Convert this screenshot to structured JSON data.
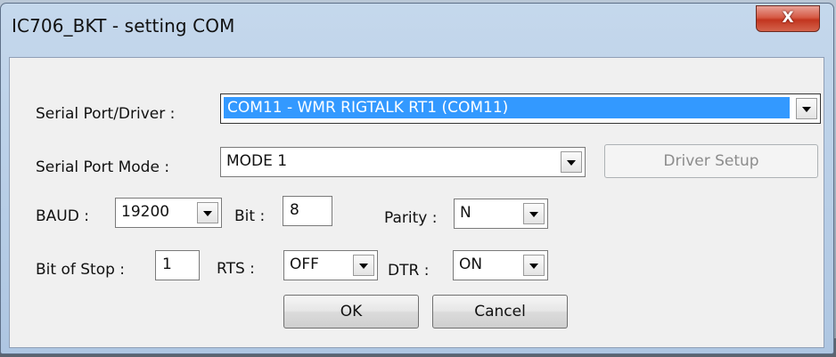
{
  "window": {
    "title": "IC706_BKT - setting COM",
    "close_label": "X"
  },
  "serial_port": {
    "label": "Serial Port/Driver :",
    "value": "COM11 - WMR RIGTALK RT1 (COM11)"
  },
  "serial_mode": {
    "label": "Serial Port Mode :",
    "value": "MODE 1",
    "driver_setup_label": "Driver Setup"
  },
  "baud": {
    "label": "BAUD :",
    "value": "19200"
  },
  "bit": {
    "label": "Bit :",
    "value": "8"
  },
  "parity": {
    "label": "Parity :",
    "value": "N"
  },
  "stop": {
    "label": "Bit of Stop :",
    "value": "1"
  },
  "rts": {
    "label": "RTS :",
    "value": "OFF"
  },
  "dtr": {
    "label": "DTR :",
    "value": "ON"
  },
  "buttons": {
    "ok": "OK",
    "cancel": "Cancel"
  },
  "colors": {
    "selection": "#3399ff",
    "close_button": "#c2351f",
    "dialog_bg": "#f0f0f0"
  }
}
